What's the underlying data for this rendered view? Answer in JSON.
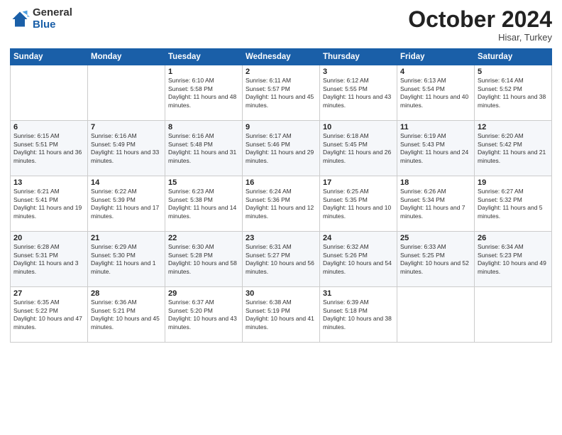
{
  "logo": {
    "general": "General",
    "blue": "Blue"
  },
  "header": {
    "month": "October 2024",
    "location": "Hisar, Turkey"
  },
  "days_of_week": [
    "Sunday",
    "Monday",
    "Tuesday",
    "Wednesday",
    "Thursday",
    "Friday",
    "Saturday"
  ],
  "weeks": [
    [
      {
        "day": "",
        "sunrise": "",
        "sunset": "",
        "daylight": ""
      },
      {
        "day": "",
        "sunrise": "",
        "sunset": "",
        "daylight": ""
      },
      {
        "day": "1",
        "sunrise": "Sunrise: 6:10 AM",
        "sunset": "Sunset: 5:58 PM",
        "daylight": "Daylight: 11 hours and 48 minutes."
      },
      {
        "day": "2",
        "sunrise": "Sunrise: 6:11 AM",
        "sunset": "Sunset: 5:57 PM",
        "daylight": "Daylight: 11 hours and 45 minutes."
      },
      {
        "day": "3",
        "sunrise": "Sunrise: 6:12 AM",
        "sunset": "Sunset: 5:55 PM",
        "daylight": "Daylight: 11 hours and 43 minutes."
      },
      {
        "day": "4",
        "sunrise": "Sunrise: 6:13 AM",
        "sunset": "Sunset: 5:54 PM",
        "daylight": "Daylight: 11 hours and 40 minutes."
      },
      {
        "day": "5",
        "sunrise": "Sunrise: 6:14 AM",
        "sunset": "Sunset: 5:52 PM",
        "daylight": "Daylight: 11 hours and 38 minutes."
      }
    ],
    [
      {
        "day": "6",
        "sunrise": "Sunrise: 6:15 AM",
        "sunset": "Sunset: 5:51 PM",
        "daylight": "Daylight: 11 hours and 36 minutes."
      },
      {
        "day": "7",
        "sunrise": "Sunrise: 6:16 AM",
        "sunset": "Sunset: 5:49 PM",
        "daylight": "Daylight: 11 hours and 33 minutes."
      },
      {
        "day": "8",
        "sunrise": "Sunrise: 6:16 AM",
        "sunset": "Sunset: 5:48 PM",
        "daylight": "Daylight: 11 hours and 31 minutes."
      },
      {
        "day": "9",
        "sunrise": "Sunrise: 6:17 AM",
        "sunset": "Sunset: 5:46 PM",
        "daylight": "Daylight: 11 hours and 29 minutes."
      },
      {
        "day": "10",
        "sunrise": "Sunrise: 6:18 AM",
        "sunset": "Sunset: 5:45 PM",
        "daylight": "Daylight: 11 hours and 26 minutes."
      },
      {
        "day": "11",
        "sunrise": "Sunrise: 6:19 AM",
        "sunset": "Sunset: 5:43 PM",
        "daylight": "Daylight: 11 hours and 24 minutes."
      },
      {
        "day": "12",
        "sunrise": "Sunrise: 6:20 AM",
        "sunset": "Sunset: 5:42 PM",
        "daylight": "Daylight: 11 hours and 21 minutes."
      }
    ],
    [
      {
        "day": "13",
        "sunrise": "Sunrise: 6:21 AM",
        "sunset": "Sunset: 5:41 PM",
        "daylight": "Daylight: 11 hours and 19 minutes."
      },
      {
        "day": "14",
        "sunrise": "Sunrise: 6:22 AM",
        "sunset": "Sunset: 5:39 PM",
        "daylight": "Daylight: 11 hours and 17 minutes."
      },
      {
        "day": "15",
        "sunrise": "Sunrise: 6:23 AM",
        "sunset": "Sunset: 5:38 PM",
        "daylight": "Daylight: 11 hours and 14 minutes."
      },
      {
        "day": "16",
        "sunrise": "Sunrise: 6:24 AM",
        "sunset": "Sunset: 5:36 PM",
        "daylight": "Daylight: 11 hours and 12 minutes."
      },
      {
        "day": "17",
        "sunrise": "Sunrise: 6:25 AM",
        "sunset": "Sunset: 5:35 PM",
        "daylight": "Daylight: 11 hours and 10 minutes."
      },
      {
        "day": "18",
        "sunrise": "Sunrise: 6:26 AM",
        "sunset": "Sunset: 5:34 PM",
        "daylight": "Daylight: 11 hours and 7 minutes."
      },
      {
        "day": "19",
        "sunrise": "Sunrise: 6:27 AM",
        "sunset": "Sunset: 5:32 PM",
        "daylight": "Daylight: 11 hours and 5 minutes."
      }
    ],
    [
      {
        "day": "20",
        "sunrise": "Sunrise: 6:28 AM",
        "sunset": "Sunset: 5:31 PM",
        "daylight": "Daylight: 11 hours and 3 minutes."
      },
      {
        "day": "21",
        "sunrise": "Sunrise: 6:29 AM",
        "sunset": "Sunset: 5:30 PM",
        "daylight": "Daylight: 11 hours and 1 minute."
      },
      {
        "day": "22",
        "sunrise": "Sunrise: 6:30 AM",
        "sunset": "Sunset: 5:28 PM",
        "daylight": "Daylight: 10 hours and 58 minutes."
      },
      {
        "day": "23",
        "sunrise": "Sunrise: 6:31 AM",
        "sunset": "Sunset: 5:27 PM",
        "daylight": "Daylight: 10 hours and 56 minutes."
      },
      {
        "day": "24",
        "sunrise": "Sunrise: 6:32 AM",
        "sunset": "Sunset: 5:26 PM",
        "daylight": "Daylight: 10 hours and 54 minutes."
      },
      {
        "day": "25",
        "sunrise": "Sunrise: 6:33 AM",
        "sunset": "Sunset: 5:25 PM",
        "daylight": "Daylight: 10 hours and 52 minutes."
      },
      {
        "day": "26",
        "sunrise": "Sunrise: 6:34 AM",
        "sunset": "Sunset: 5:23 PM",
        "daylight": "Daylight: 10 hours and 49 minutes."
      }
    ],
    [
      {
        "day": "27",
        "sunrise": "Sunrise: 6:35 AM",
        "sunset": "Sunset: 5:22 PM",
        "daylight": "Daylight: 10 hours and 47 minutes."
      },
      {
        "day": "28",
        "sunrise": "Sunrise: 6:36 AM",
        "sunset": "Sunset: 5:21 PM",
        "daylight": "Daylight: 10 hours and 45 minutes."
      },
      {
        "day": "29",
        "sunrise": "Sunrise: 6:37 AM",
        "sunset": "Sunset: 5:20 PM",
        "daylight": "Daylight: 10 hours and 43 minutes."
      },
      {
        "day": "30",
        "sunrise": "Sunrise: 6:38 AM",
        "sunset": "Sunset: 5:19 PM",
        "daylight": "Daylight: 10 hours and 41 minutes."
      },
      {
        "day": "31",
        "sunrise": "Sunrise: 6:39 AM",
        "sunset": "Sunset: 5:18 PM",
        "daylight": "Daylight: 10 hours and 38 minutes."
      },
      {
        "day": "",
        "sunrise": "",
        "sunset": "",
        "daylight": ""
      },
      {
        "day": "",
        "sunrise": "",
        "sunset": "",
        "daylight": ""
      }
    ]
  ]
}
